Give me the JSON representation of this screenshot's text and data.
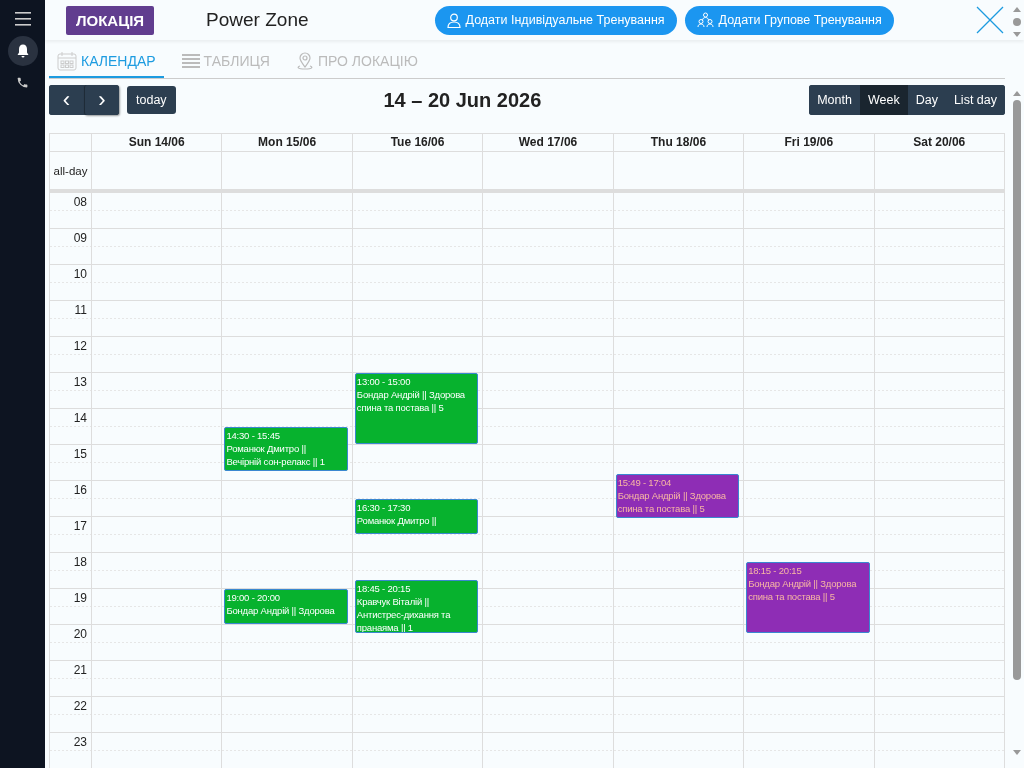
{
  "header": {
    "badge": "ЛОКАЦІЯ",
    "title": "Power Zone",
    "actions": [
      {
        "kind": "person",
        "label": "Додати Індивідуальне Тренування"
      },
      {
        "kind": "group",
        "label": "Додати Групове Тренування"
      }
    ]
  },
  "tabs": [
    {
      "kind": "calendar",
      "label": "КАЛЕНДАР",
      "selected": true
    },
    {
      "kind": "table",
      "label": "ТАБЛИЦЯ",
      "selected": false
    },
    {
      "kind": "pin",
      "label": "ПРО ЛОКАЦІЮ",
      "selected": false
    }
  ],
  "toolbar": {
    "prev": "‹",
    "next": "›",
    "today": "today",
    "range": "14 – 20 Jun 2026",
    "views": [
      {
        "label": "Month",
        "selected": false
      },
      {
        "label": "Week",
        "selected": true
      },
      {
        "label": "Day",
        "selected": false
      },
      {
        "label": "List day",
        "selected": false
      }
    ]
  },
  "calendar": {
    "allday_label": "all-day",
    "hours": [
      "08",
      "09",
      "10",
      "11",
      "12",
      "13",
      "14",
      "15",
      "16",
      "17",
      "18",
      "19",
      "20",
      "21",
      "22",
      "23"
    ],
    "days": [
      {
        "label": "Sun 14/06"
      },
      {
        "label": "Mon 15/06",
        "events": [
          {
            "time": "14:30 - 15:45",
            "lines": [
              "Романюк Дмитро ||",
              "Вечірній сон-релакс || 1"
            ],
            "color": "#07b22e"
          },
          {
            "time": "19:00 - 20:00",
            "lines": [
              "Бондар Андрій || Здорова"
            ],
            "color": "#07b22e"
          }
        ]
      },
      {
        "label": "Tue 16/06",
        "events": [
          {
            "time": "13:00 - 15:00",
            "lines": [
              "Бондар Андрій || Здорова",
              "спина та постава || 5"
            ],
            "color": "#07b22e"
          },
          {
            "time": "16:30 - 17:30",
            "lines": [
              "Романюк Дмитро ||"
            ],
            "color": "#07b22e"
          },
          {
            "time": "18:45 - 20:15",
            "lines": [
              "Кравчук Віталій ||",
              "Антистрес-дихання та",
              "пранаяма || 1"
            ],
            "color": "#07b22e"
          }
        ]
      },
      {
        "label": "Wed 17/06"
      },
      {
        "label": "Thu 18/06",
        "events": [
          {
            "time": "15:49 - 17:04",
            "lines": [
              "Бондар Андрій || Здорова",
              "спина та постава || 5"
            ],
            "color": "#8e2db5"
          }
        ]
      },
      {
        "label": "Fri 19/06",
        "events": [
          {
            "time": "18:15 - 20:15",
            "lines": [
              "Бондар Андрій || Здорова",
              "спина та постава || 5"
            ],
            "color": "#8e2db5"
          }
        ]
      },
      {
        "label": "Sat 20/06"
      }
    ]
  }
}
